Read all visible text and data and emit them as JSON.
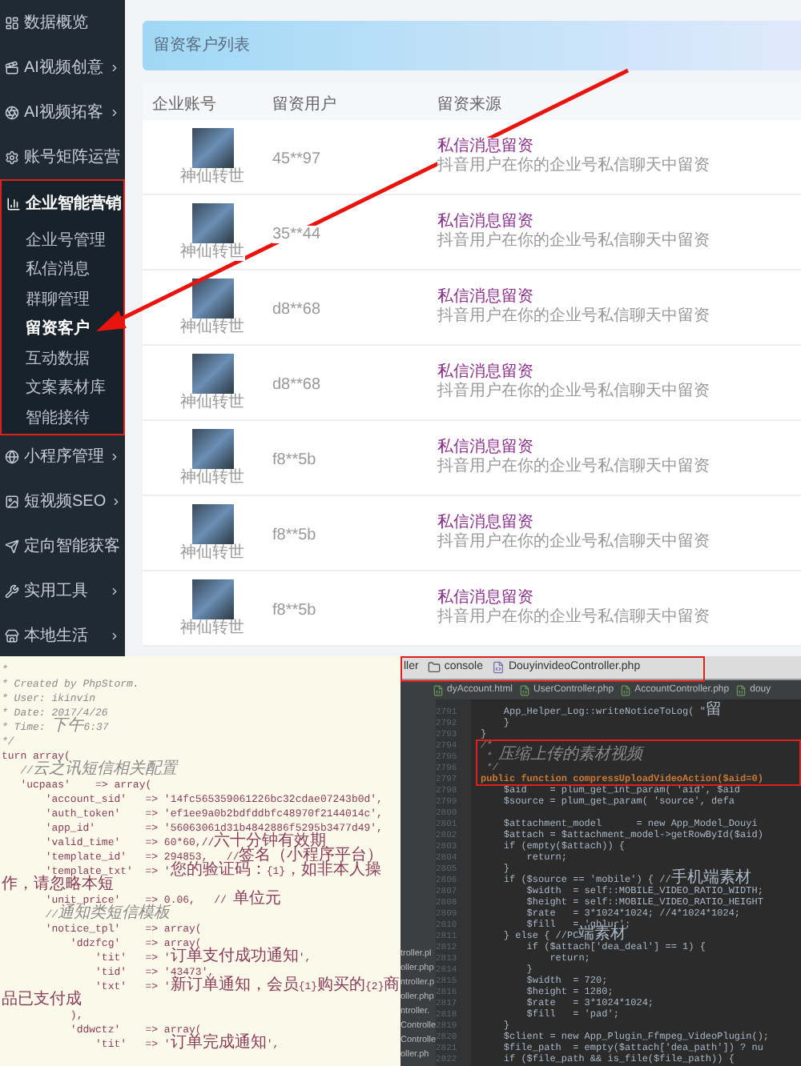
{
  "sidebar": {
    "items": [
      {
        "label": "数据概览",
        "kind": "link",
        "expanded": false
      },
      {
        "label": "AI视频创意",
        "kind": "group",
        "expanded": false
      },
      {
        "label": "AI视频拓客",
        "kind": "group",
        "expanded": false
      },
      {
        "label": "账号矩阵运营",
        "kind": "group",
        "expanded": false
      },
      {
        "label": "企业智能营销",
        "kind": "group",
        "expanded": true,
        "children": [
          {
            "label": "企业号管理",
            "selected": false
          },
          {
            "label": "私信消息",
            "selected": false
          },
          {
            "label": "群聊管理",
            "selected": false
          },
          {
            "label": "留资客户",
            "selected": true
          },
          {
            "label": "互动数据",
            "selected": false
          },
          {
            "label": "文案素材库",
            "selected": false
          },
          {
            "label": "智能接待",
            "selected": false
          }
        ]
      },
      {
        "label": "小程序管理",
        "kind": "group",
        "expanded": false
      },
      {
        "label": "短视频SEO",
        "kind": "group",
        "expanded": false
      },
      {
        "label": "定向智能获客",
        "kind": "group",
        "expanded": false
      },
      {
        "label": "实用工具",
        "kind": "group",
        "expanded": false
      },
      {
        "label": "本地生活",
        "kind": "group",
        "expanded": false
      }
    ]
  },
  "panel": {
    "title": "留资客户列表"
  },
  "table": {
    "columns": [
      "企业账号",
      "留资用户",
      "留资来源"
    ],
    "rows": [
      {
        "account": "神仙转世",
        "user": "45**97",
        "source_title": "私信消息留资",
        "source_desc": "抖音用户在你的企业号私信聊天中留资"
      },
      {
        "account": "神仙转世",
        "user": "35**44",
        "source_title": "私信消息留资",
        "source_desc": "抖音用户在你的企业号私信聊天中留资"
      },
      {
        "account": "神仙转世",
        "user": "d8**68",
        "source_title": "私信消息留资",
        "source_desc": "抖音用户在你的企业号私信聊天中留资"
      },
      {
        "account": "神仙转世",
        "user": "d8**68",
        "source_title": "私信消息留资",
        "source_desc": "抖音用户在你的企业号私信聊天中留资"
      },
      {
        "account": "神仙转世",
        "user": "f8**5b",
        "source_title": "私信消息留资",
        "source_desc": "抖音用户在你的企业号私信聊天中留资"
      },
      {
        "account": "神仙转世",
        "user": "f8**5b",
        "source_title": "私信消息留资",
        "source_desc": "抖音用户在你的企业号私信聊天中留资"
      },
      {
        "account": "神仙转世",
        "user": "f8**5b",
        "source_title": "私信消息留资",
        "source_desc": "抖音用户在你的企业号私信聊天中留资"
      }
    ]
  },
  "code_left": {
    "lines": [
      {
        "text": "*",
        "kind": "comment"
      },
      {
        "text": "* Created by PhpStorm.",
        "kind": "comment"
      },
      {
        "text": "* User: ikinvin",
        "kind": "comment"
      },
      {
        "text": "* Date: 2017/4/26",
        "kind": "comment"
      },
      {
        "text": "* Time: 下午6:37",
        "kind": "comment"
      },
      {
        "text": "*/",
        "kind": "comment"
      },
      {
        "text": "turn array(",
        "kind": "code"
      },
      {
        "text": "   //云之讯短信相关配置",
        "kind": "comment"
      },
      {
        "text": "   'ucpaas'    => array(",
        "kind": "code"
      },
      {
        "text": "       'account_sid'   => '14fc565359061226bc32cdae07243b0d',",
        "kind": "code"
      },
      {
        "text": "       'auth_token'    => 'ef1ee9a0b2bdfddbfc48970f2144014c',",
        "kind": "code"
      },
      {
        "text": "       'app_id'        => '56063061d31b4842886f5295b3477d49',",
        "kind": "code"
      },
      {
        "text": "       'valid_time'    => 60*60,//六十分钟有效期",
        "kind": "code"
      },
      {
        "text": "       'template_id'   => 294853,   //签名（小程序平台）",
        "kind": "code"
      },
      {
        "text": "       'template_txt'  => '您的验证码：{1}，如非本人操作，请忽略本短",
        "kind": "code"
      },
      {
        "text": "       'unit_price'    => 0.06,   // 单位元",
        "kind": "code"
      },
      {
        "text": "       //通知类短信模板",
        "kind": "comment"
      },
      {
        "text": "       'notice_tpl'    => array(",
        "kind": "code"
      },
      {
        "text": "           'ddzfcg'    => array(",
        "kind": "code"
      },
      {
        "text": "               'tit'   => '订单支付成功通知',",
        "kind": "code"
      },
      {
        "text": "               'tid'   => '43473',",
        "kind": "code"
      },
      {
        "text": "               'txt'   => '新订单通知，会员{1}购买的{2}商品已支付成",
        "kind": "code"
      },
      {
        "text": "           ),",
        "kind": "code"
      },
      {
        "text": "           'ddwctz'    => array(",
        "kind": "code"
      },
      {
        "text": "               'tit'   => '订单完成通知',",
        "kind": "code"
      }
    ]
  },
  "ide": {
    "tool_tabs": [
      {
        "label": "ller",
        "kind": "text"
      },
      {
        "label": "console",
        "kind": "folder"
      },
      {
        "label": "DouyinvideoController.php",
        "kind": "file"
      }
    ],
    "file_tabs": [
      "dyAccount.html",
      "UserController.php",
      "AccountController.php",
      "douy"
    ],
    "file_list": [
      "troller.pl",
      "oller.php",
      "ntroller.p",
      "oller.php",
      "ntroller.",
      "Controlle",
      "Controlle",
      "oller.ph"
    ],
    "lines": [
      {
        "number": "2791",
        "text": "    App_Helper_Log::writeNoticeToLog( \"留",
        "kind": "code"
      },
      {
        "number": "2792",
        "text": "    }",
        "kind": "code"
      },
      {
        "number": "2793",
        "text": "}",
        "kind": "code"
      },
      {
        "number": "2794",
        "text": "/*",
        "kind": "comment"
      },
      {
        "number": "2795",
        "text": " * 压缩上传的素材视频",
        "kind": "comment"
      },
      {
        "number": "2796",
        "text": " */",
        "kind": "comment"
      },
      {
        "number": "2797",
        "text": "public function compressUploadVideoAction($aid=0)",
        "kind": "declaration"
      },
      {
        "number": "2798",
        "text": "    $aid    = plum_get_int_param( 'aid', $aid",
        "kind": "code"
      },
      {
        "number": "2799",
        "text": "    $source = plum_get_param( 'source', defa",
        "kind": "code"
      },
      {
        "number": "2800"
      },
      {
        "number": "2801",
        "text": "    $attachment_model      = new App_Model_Douyi",
        "kind": "code"
      },
      {
        "number": "2802",
        "text": "    $attach = $attachment_model->getRowById($aid)",
        "kind": "code"
      },
      {
        "number": "2803",
        "text": "    if (empty($attach)) {",
        "kind": "code"
      },
      {
        "number": "2804",
        "text": "        return;",
        "kind": "code"
      },
      {
        "number": "2805",
        "text": "    }",
        "kind": "code"
      },
      {
        "number": "2806",
        "text": "    if ($source == 'mobile') { //手机端素材",
        "kind": "code"
      },
      {
        "number": "2807",
        "text": "        $width  = self::MOBILE_VIDEO_RATIO_WIDTH;",
        "kind": "code"
      },
      {
        "number": "2808",
        "text": "        $height = self::MOBILE_VIDEO_RATIO_HEIGHT",
        "kind": "code"
      },
      {
        "number": "2809",
        "text": "        $rate   = 3*1024*1024; //4*1024*1024;",
        "kind": "code"
      },
      {
        "number": "2810",
        "text": "        $fill   = 'gblur';",
        "kind": "code"
      },
      {
        "number": "2811",
        "text": "    } else { //PC端素材",
        "kind": "code"
      },
      {
        "number": "2812",
        "text": "        if ($attach['dea_deal'] == 1) {",
        "kind": "code"
      },
      {
        "number": "2813",
        "text": "            return;",
        "kind": "code"
      },
      {
        "number": "2814",
        "text": "        }",
        "kind": "code"
      },
      {
        "number": "2815",
        "text": "        $width  = 720;",
        "kind": "code"
      },
      {
        "number": "2816",
        "text": "        $height = 1280;",
        "kind": "code"
      },
      {
        "number": "2817",
        "text": "        $rate   = 3*1024*1024;",
        "kind": "code"
      },
      {
        "number": "2818",
        "text": "        $fill   = 'pad';",
        "kind": "code"
      },
      {
        "number": "2819",
        "text": "    }",
        "kind": "code"
      },
      {
        "number": "2820",
        "text": "    $client = new App_Plugin_Ffmpeg_VideoPlugin();",
        "kind": "code"
      },
      {
        "number": "2821",
        "text": "    $file_path  = empty($attach['dea_path']) ? nu",
        "kind": "code"
      },
      {
        "number": "2822",
        "text": "    if ($file_path && is_file($file_path)) {",
        "kind": "code"
      }
    ]
  }
}
